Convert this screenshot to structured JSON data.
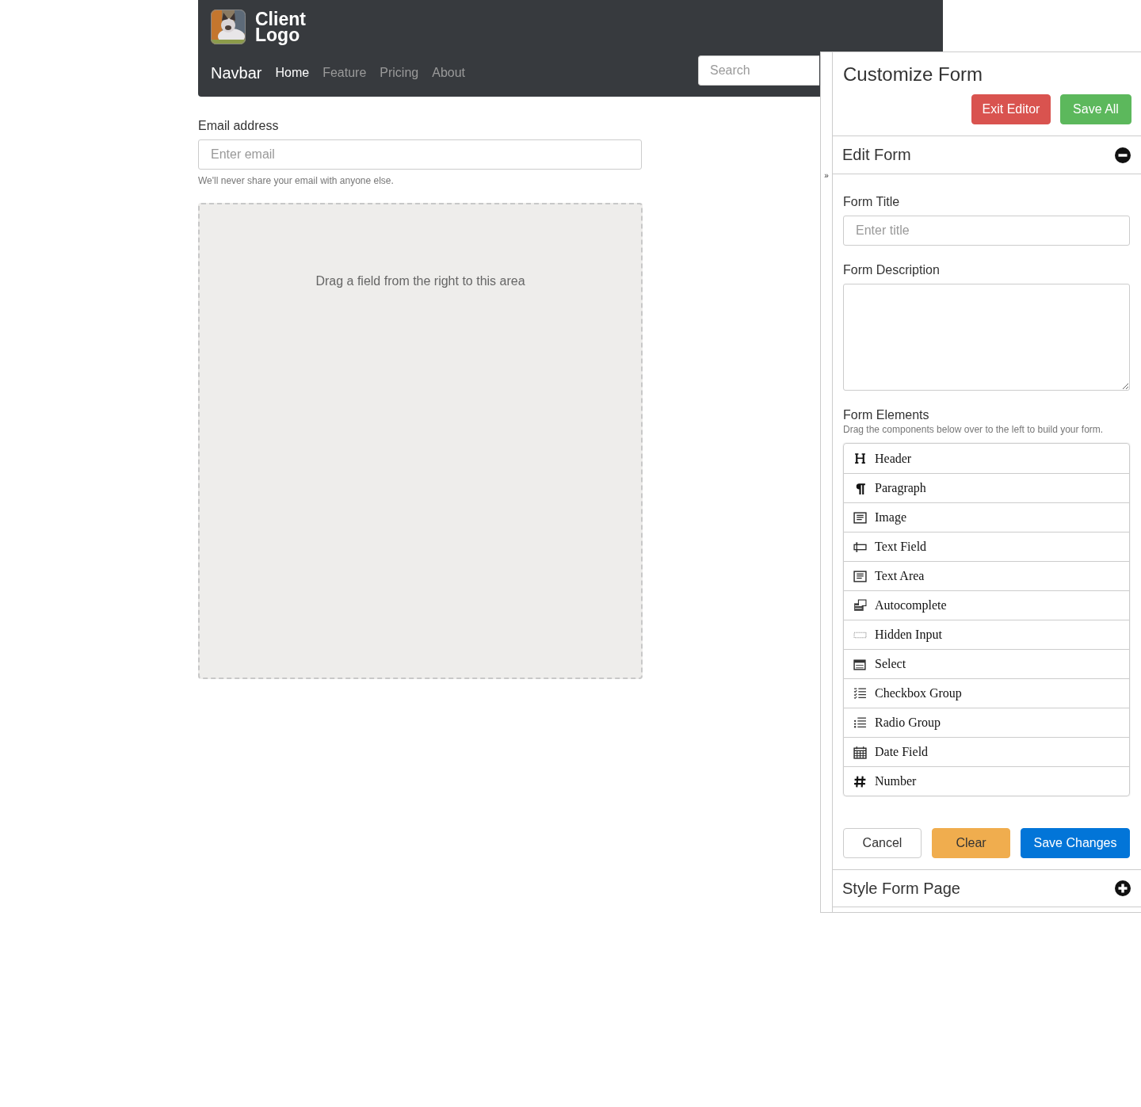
{
  "navbar": {
    "logo_text": [
      "Client",
      "Logo"
    ],
    "brand": "Navbar",
    "links": [
      {
        "label": "Home",
        "selected": true
      },
      {
        "label": "Feature",
        "selected": false
      },
      {
        "label": "Pricing",
        "selected": false
      },
      {
        "label": "About",
        "selected": false
      }
    ],
    "search": {
      "placeholder": "Search"
    }
  },
  "email": {
    "label": "Email address",
    "placeholder": "Enter email",
    "help": "We'll never share your email with anyone else."
  },
  "drop_area": {
    "text": "Drag a field from the right to this area"
  },
  "panel": {
    "toggle": "»",
    "title": "Customize Form",
    "buttons": [
      {
        "label": "Exit Editor",
        "kind": "danger"
      },
      {
        "label": "Save All",
        "kind": "success"
      }
    ],
    "sections": [
      {
        "title": "Edit Form",
        "expanded": true
      },
      {
        "title": "Style Form Page",
        "expanded": false
      }
    ],
    "form_title": {
      "label": "Form Title",
      "placeholder": "Enter title"
    },
    "form_description": {
      "label": "Form Description"
    },
    "elements_heading": "Form Elements",
    "elements_hint": "Drag the components below over to the left to build your form.",
    "elements": [
      {
        "label": "Header",
        "kind": "header"
      },
      {
        "label": "Paragraph",
        "kind": "paragraph"
      },
      {
        "label": "Image",
        "kind": "lines"
      },
      {
        "label": "Text Field",
        "kind": "textfield"
      },
      {
        "label": "Text Area",
        "kind": "lines"
      },
      {
        "label": "Autocomplete",
        "kind": "autocomplete"
      },
      {
        "label": "Hidden Input",
        "kind": "hidden"
      },
      {
        "label": "Select",
        "kind": "select"
      },
      {
        "label": "Checkbox Group",
        "kind": "checklist"
      },
      {
        "label": "Radio Group",
        "kind": "radiolist"
      },
      {
        "label": "Date Field",
        "kind": "calendar"
      },
      {
        "label": "Number",
        "kind": "number"
      }
    ],
    "actions": [
      {
        "label": "Cancel",
        "kind": "default"
      },
      {
        "label": "Clear",
        "kind": "warning"
      },
      {
        "label": "Save Changes",
        "kind": "primary"
      }
    ]
  }
}
